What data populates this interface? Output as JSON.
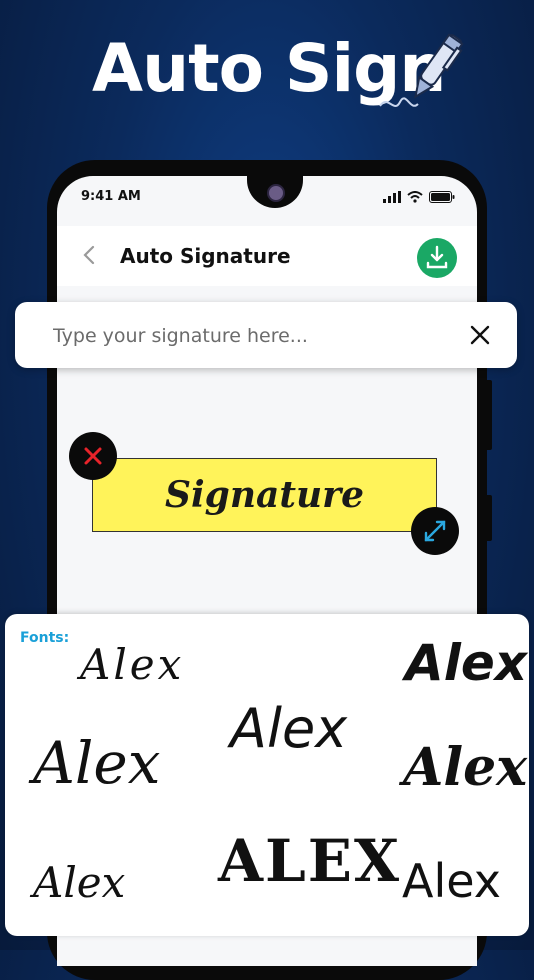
{
  "hero": {
    "title": "Auto Sign"
  },
  "status_bar": {
    "time": "9:41 AM"
  },
  "app_bar": {
    "title": "Auto Signature"
  },
  "search": {
    "placeholder": "Type your signature here..."
  },
  "signature": {
    "text": "Signature",
    "box_color": "#fff35a"
  },
  "fonts": {
    "label": "Fonts:",
    "options": [
      "Alex",
      "Alex",
      "Alex",
      "Alex",
      "Alex",
      "Alex",
      "ALEX",
      "Alex"
    ]
  },
  "colors": {
    "accent_green": "#1aa865",
    "fonts_label": "#1aa0d8",
    "background": "#0b2a5c",
    "delete": "#e8232a",
    "resize": "#2aa8e0"
  },
  "icons": [
    "pen-icon",
    "back-chevron-icon",
    "download-icon",
    "close-icon",
    "delete-x-icon",
    "resize-arrows-icon",
    "signal-icon",
    "wifi-icon",
    "battery-icon"
  ]
}
